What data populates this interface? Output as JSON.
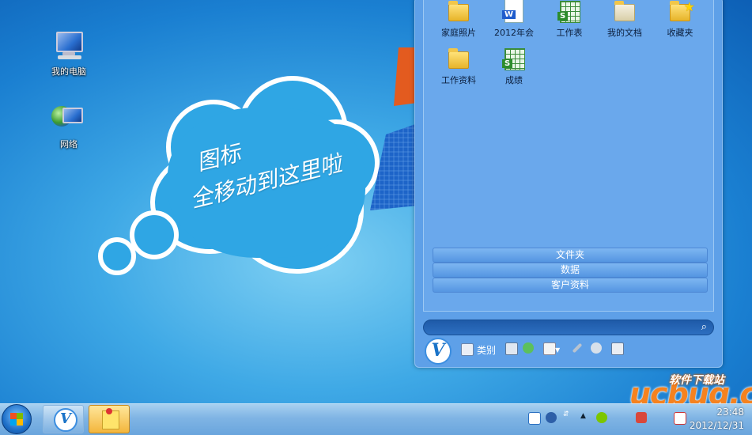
{
  "desktop": {
    "icons": [
      {
        "label": "我的电脑",
        "icon": "computer-icon"
      },
      {
        "label": "网络",
        "icon": "network-icon"
      }
    ],
    "cloud_line1": "图标",
    "cloud_line2": "全移动到这里啦"
  },
  "panel": {
    "files": [
      {
        "label": "家庭照片",
        "type": "folder"
      },
      {
        "label": "2012年会",
        "type": "word-doc"
      },
      {
        "label": "工作表",
        "type": "spreadsheet"
      },
      {
        "label": "我的文档",
        "type": "document-folder"
      },
      {
        "label": "收藏夹",
        "type": "favorites-folder"
      },
      {
        "label": "工作资料",
        "type": "folder"
      },
      {
        "label": "成绩",
        "type": "spreadsheet"
      }
    ],
    "categories": [
      "文件夹",
      "数据",
      "客户资料"
    ],
    "search_placeholder": "",
    "toolbar": {
      "logo": "V",
      "category_label": "类别"
    },
    "word_badge": "W",
    "sheet_badge": "S"
  },
  "taskbar": {
    "vbutton": "V",
    "time": "23:48",
    "date": "2012/12/31"
  },
  "watermark": {
    "main": "ucbug.cc",
    "sub": "软件下载站"
  },
  "colors": {
    "accent": "#2fa6e4",
    "panel_bg": "#5ea0e8",
    "watermark": "#f5821f"
  }
}
